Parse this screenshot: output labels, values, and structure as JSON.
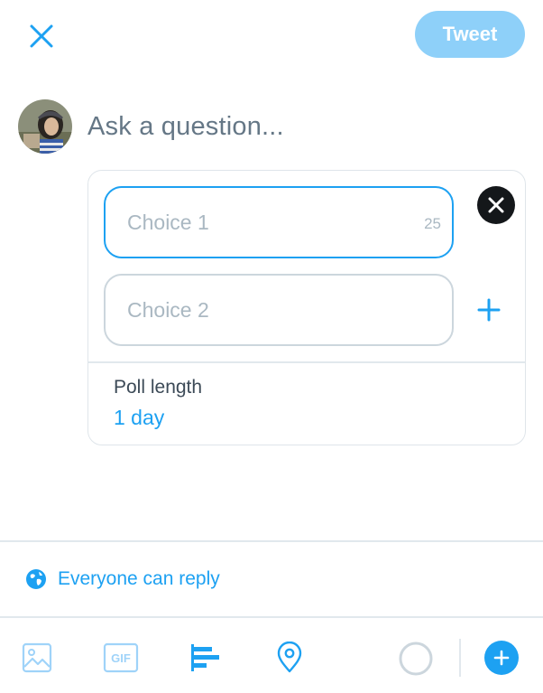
{
  "header": {
    "close_icon": "close-icon",
    "tweet_label": "Tweet"
  },
  "composer": {
    "avatar": "avatar",
    "placeholder": "Ask a question..."
  },
  "poll": {
    "choices": [
      {
        "placeholder": "Choice 1",
        "char_count": "25"
      },
      {
        "placeholder": "Choice 2"
      }
    ],
    "length_label": "Poll length",
    "length_value": "1 day"
  },
  "reply_setting": {
    "icon": "globe-icon",
    "label": "Everyone can reply"
  },
  "toolbar": {
    "gif_label": "GIF",
    "icons": [
      "image-icon",
      "gif-icon",
      "poll-icon",
      "location-icon",
      "character-count-ring",
      "add-tweet-icon"
    ]
  },
  "colors": {
    "accent": "#1da1f2",
    "tweet_button_disabled": "#8ed0f9",
    "placeholder": "#aab8c2",
    "border": "#e1e8ed"
  }
}
